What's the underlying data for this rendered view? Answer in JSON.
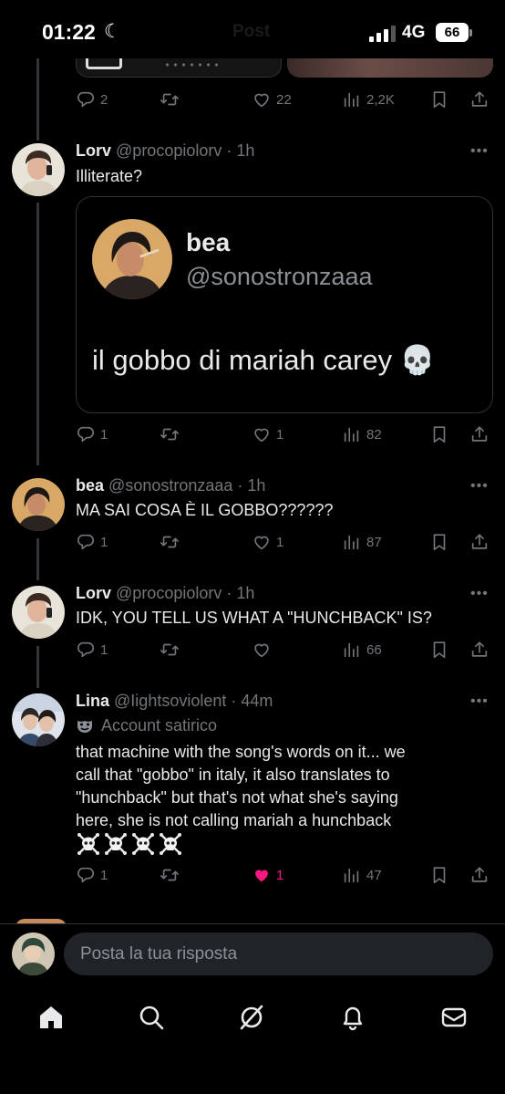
{
  "status_bar": {
    "time": "01:22",
    "network": "4G",
    "battery": "66",
    "faded_title": "Post"
  },
  "top_tweet_actions": {
    "replies": "2",
    "reposts": "",
    "likes": "22",
    "views": "2,2K"
  },
  "tweets": [
    {
      "name": "Lorv",
      "handle": "@procopiolorv",
      "time": "1h",
      "text": "Illiterate?",
      "quote": {
        "name": "bea",
        "handle": "@sonostronzaaa",
        "text": "il gobbo di mariah carey 💀"
      },
      "replies": "1",
      "likes": "1",
      "views": "82"
    },
    {
      "name": "bea",
      "handle": "@sonostronzaaa",
      "time": "1h",
      "text": "MA SAI COSA È IL GOBBO??????",
      "replies": "1",
      "likes": "1",
      "views": "87"
    },
    {
      "name": "Lorv",
      "handle": "@procopiolorv",
      "time": "1h",
      "text": "IDK, YOU TELL US WHAT A \"HUNCHBACK\" IS?",
      "replies": "1",
      "likes": "",
      "views": "66"
    },
    {
      "name": "Lina",
      "handle": "@Iightsoviolent",
      "time": "44m",
      "label": "Account satirico",
      "text_lines": [
        "that machine with the song's words on it... we",
        "call that \"gobbo\" in italy, it also translates to",
        "\"hunchback\" but that's not what she's saying",
        "here, she is not calling mariah a hunchback"
      ],
      "replies": "1",
      "likes": "1",
      "views": "47"
    }
  ],
  "reply_bar": {
    "placeholder": "Posta la tua risposta"
  },
  "nav": [
    "home-icon",
    "search-icon",
    "grok-icon",
    "notifications-icon",
    "messages-icon"
  ],
  "colors": {
    "background": "#000000",
    "text": "#e7e9ea",
    "muted": "#71767b",
    "like_active": "#f91880",
    "border": "#2f3336"
  }
}
